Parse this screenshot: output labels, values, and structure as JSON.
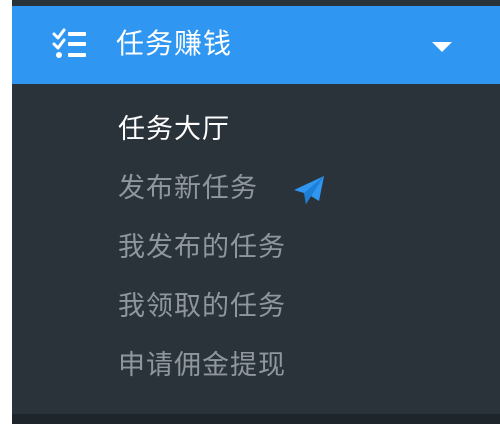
{
  "menu": {
    "header": {
      "title": "任务赚钱",
      "icon": "list-check-icon",
      "caret_icon": "caret-down-icon",
      "background_color": "#2f97f1"
    },
    "items": [
      {
        "label": "任务大厅",
        "active": true
      },
      {
        "label": "发布新任务",
        "active": false,
        "icon": "paper-plane-icon",
        "icon_color": "#2f97f1"
      },
      {
        "label": "我发布的任务",
        "active": false
      },
      {
        "label": "我领取的任务",
        "active": false
      },
      {
        "label": "申请佣金提现",
        "active": false
      }
    ],
    "submenu_background": "#2b333a",
    "active_text_color": "#ffffff",
    "inactive_text_color": "#8f969c"
  }
}
